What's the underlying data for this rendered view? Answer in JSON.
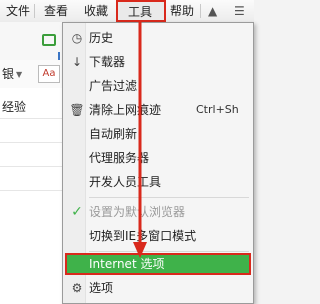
{
  "menubar": {
    "items": [
      "文件",
      "查看",
      "收藏",
      "工具",
      "帮助"
    ],
    "right_icons": [
      "shirt-icon",
      "menu-icon"
    ]
  },
  "toolbar": {
    "left_partial_label": "银",
    "left_partial_label2": "经验",
    "icons": [
      "green-share-icon",
      "download-arrow-icon",
      "font-size-icon"
    ]
  },
  "tools_menu": {
    "items": [
      {
        "label": "历史",
        "icon": "clock-icon"
      },
      {
        "label": "下载器",
        "icon": "download-icon"
      },
      {
        "label": "广告过滤",
        "icon": ""
      },
      {
        "label": "清除上网痕迹",
        "icon": "trash-icon",
        "shortcut": "Ctrl+Sh"
      },
      {
        "label": "自动刷新",
        "icon": ""
      },
      {
        "label": "代理服务器",
        "icon": ""
      },
      {
        "label": "开发人员工具",
        "icon": ""
      },
      {
        "label": "设置为默认浏览器",
        "icon": "checkmark-icon",
        "disabled": true
      },
      {
        "label": "切换到IE多窗口模式",
        "icon": ""
      },
      {
        "label": "Internet 选项",
        "icon": "",
        "highlighted": true
      },
      {
        "label": "选项",
        "icon": "gear-icon"
      }
    ]
  },
  "colors": {
    "highlight_green": "#3fb24a",
    "annotation_red": "#d9291c"
  }
}
